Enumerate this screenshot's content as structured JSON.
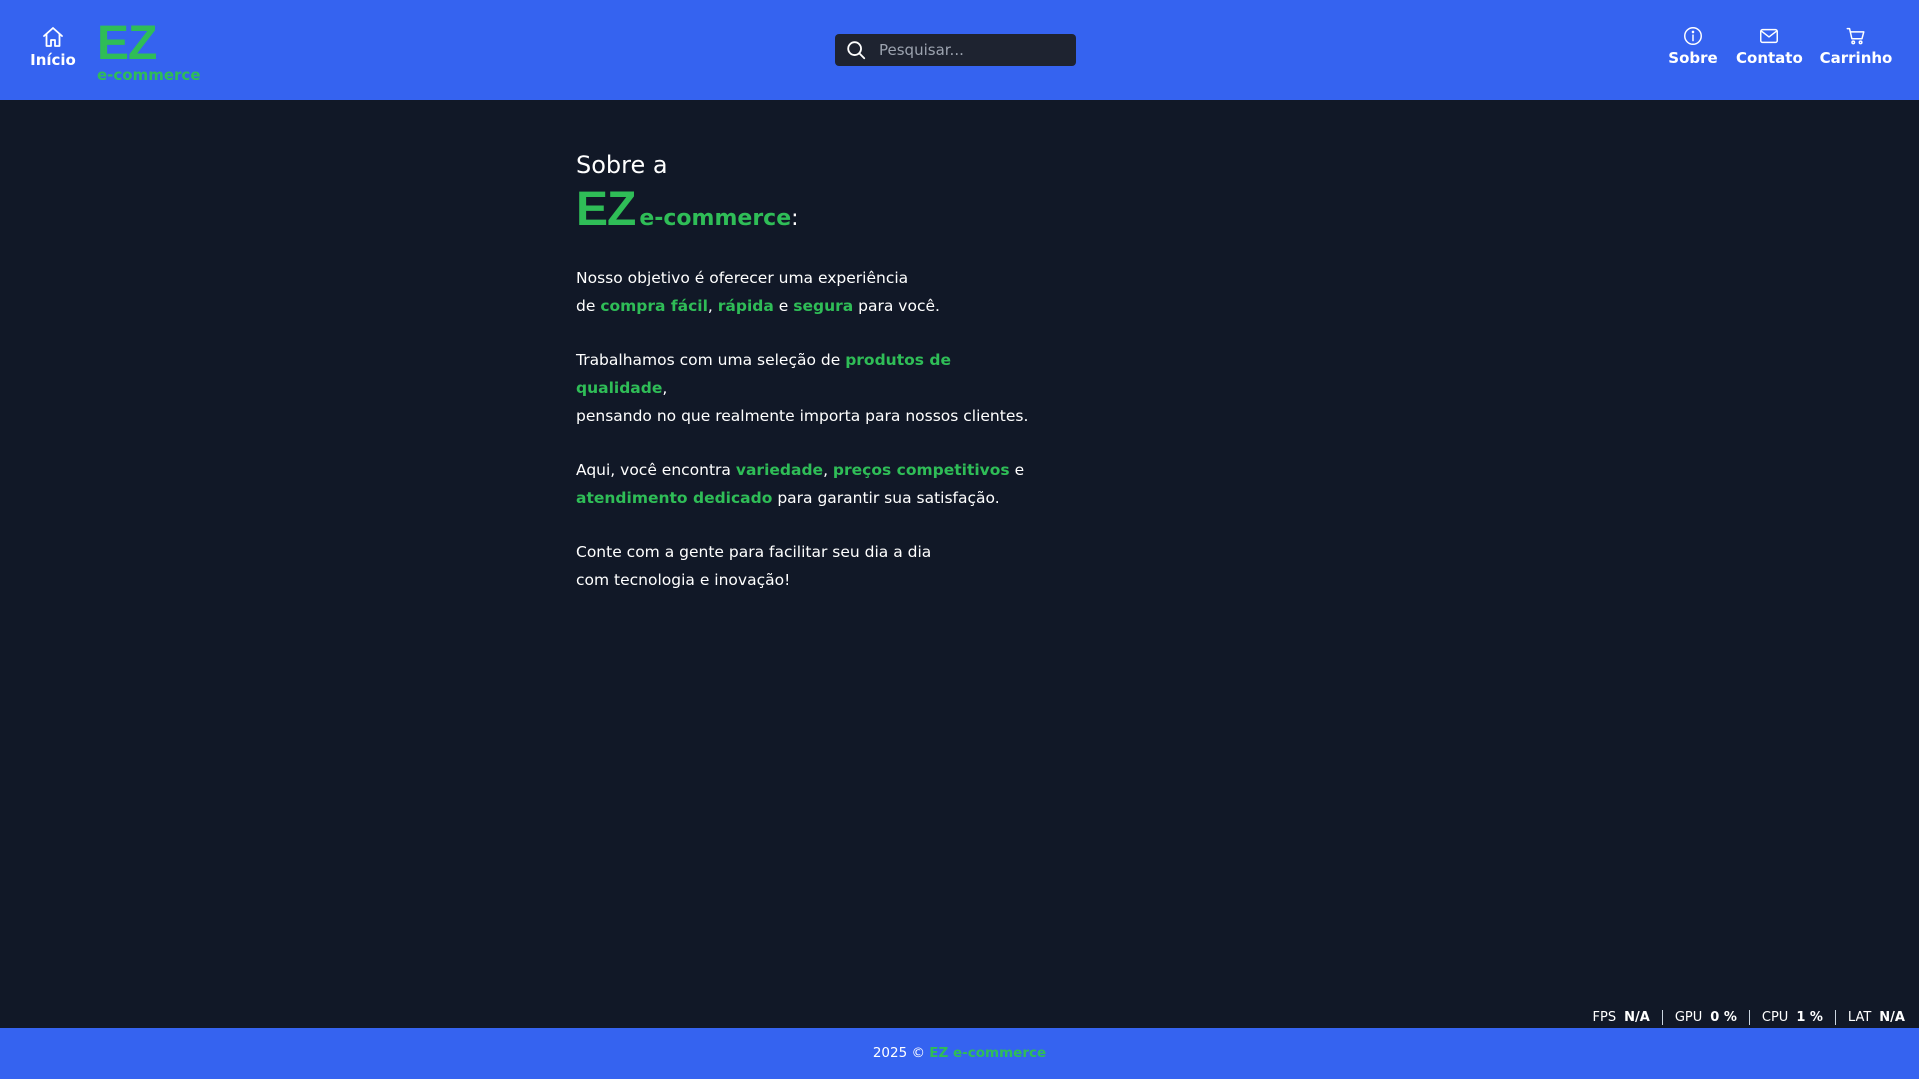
{
  "header": {
    "home_label": "Início",
    "logo": {
      "main": "EZ",
      "sub": "e-commerce"
    },
    "search": {
      "placeholder": "Pesquisar...",
      "value": ""
    },
    "nav": {
      "sobre": "Sobre",
      "contato": "Contato",
      "carrinho": "Carrinho"
    }
  },
  "about": {
    "prefix": "Sobre a",
    "brand_main": "EZ",
    "brand_sub": "e-commerce",
    "colon": ":",
    "p1": {
      "t1": "Nosso objetivo é oferecer uma experiência",
      "t2": "de ",
      "h1": "compra fácil",
      "t3": ", ",
      "h2": "rápida",
      "t4": " e ",
      "h3": "segura",
      "t5": " para você."
    },
    "p2": {
      "t1": "Trabalhamos com uma seleção de ",
      "h1": "produtos de qualidade",
      "t2": ",",
      "t3": "pensando no que realmente importa para nossos clientes."
    },
    "p3": {
      "t1": "Aqui, você encontra ",
      "h1": "variedade",
      "t2": ", ",
      "h2": "preços competitivos",
      "t3": " e",
      "h3": "atendimento dedicado",
      "t4": " para garantir sua satisfação."
    },
    "p4": {
      "t1": "Conte com a gente para facilitar seu dia a dia",
      "t2": "com tecnologia e inovação!"
    }
  },
  "perf": {
    "fps_label": "FPS",
    "fps_value": "N/A",
    "gpu_label": "GPU",
    "gpu_value": "0 %",
    "cpu_label": "CPU",
    "cpu_value": "1 %",
    "lat_label": "LAT",
    "lat_value": "N/A"
  },
  "footer": {
    "year": "2025 © ",
    "brand": "EZ e-commerce"
  },
  "colors": {
    "header_bg": "#3563f0",
    "page_bg": "#111827",
    "accent_green": "#2fbd57",
    "search_bg": "#1e2330"
  },
  "icons": {
    "home": "home-icon",
    "search": "search-icon",
    "info": "info-icon",
    "mail": "mail-icon",
    "cart": "cart-icon"
  }
}
